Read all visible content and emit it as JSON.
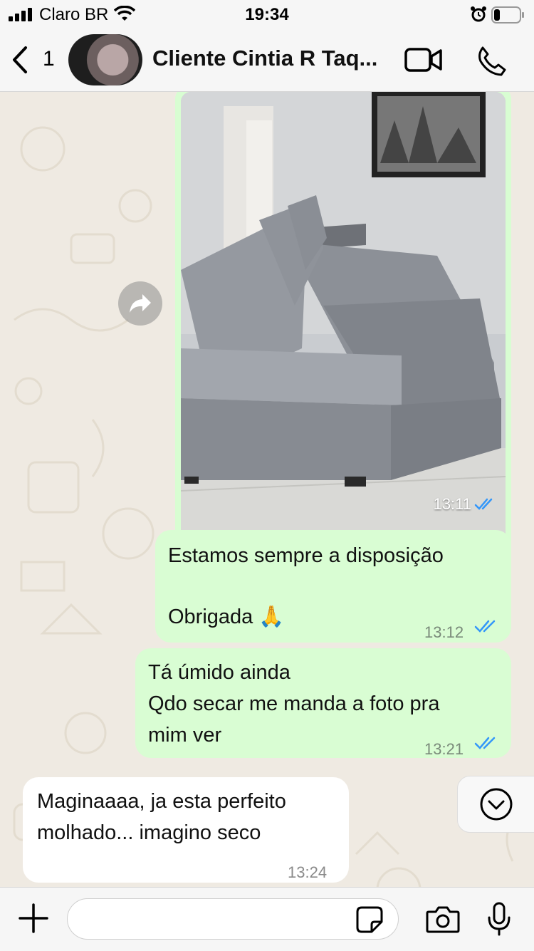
{
  "status_bar": {
    "carrier": "Claro BR",
    "time": "19:34"
  },
  "header": {
    "back_count": "1",
    "contact_name": "Cliente Cintia R Taq..."
  },
  "messages": {
    "photo": {
      "time": "13:11"
    },
    "m1": {
      "line1": "Estamos sempre a disposição",
      "line2": "Obrigada 🙏",
      "time": "13:12"
    },
    "m2": {
      "line1": "Tá úmido ainda",
      "line2": "Qdo secar me manda a foto pra",
      "line3": "mim ver",
      "time": "13:21"
    },
    "m3": {
      "line1": "Maginaaaa, ja esta perfeito",
      "line2": "molhado... imagino seco",
      "time": "13:24"
    }
  },
  "input": {
    "placeholder": ""
  },
  "colors": {
    "outgoing": "#d9fdd3",
    "incoming": "#ffffff",
    "read_ticks": "#3497f9",
    "wallpaper": "#efeae2"
  }
}
